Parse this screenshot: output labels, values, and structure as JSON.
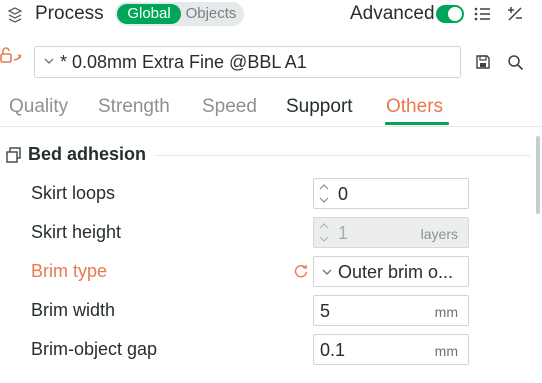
{
  "header": {
    "title": "Process",
    "segments": {
      "global": "Global",
      "objects": "Objects",
      "selected": "Global"
    },
    "advanced_label": "Advanced",
    "advanced_on": true
  },
  "preset": {
    "value": "* 0.08mm Extra Fine @BBL A1"
  },
  "tabs": {
    "items": [
      "Quality",
      "Strength",
      "Speed",
      "Support",
      "Others"
    ],
    "active": "Others"
  },
  "section": {
    "title": "Bed adhesion"
  },
  "params": {
    "skirt_loops": {
      "label": "Skirt loops",
      "value": "0"
    },
    "skirt_height": {
      "label": "Skirt height",
      "value": "1",
      "unit": "layers"
    },
    "brim_type": {
      "label": "Brim type",
      "value": "Outer brim o..."
    },
    "brim_width": {
      "label": "Brim width",
      "value": "5",
      "unit": "mm"
    },
    "brim_gap": {
      "label": "Brim-object gap",
      "value": "0.1",
      "unit": "mm"
    }
  },
  "colors": {
    "accent_green": "#00a658",
    "modified_orange": "#e87a4e",
    "text": "#262e30",
    "muted": "#8b9194"
  },
  "icons": [
    "process-icon",
    "toggle",
    "list-icon",
    "compare-icon",
    "link-icon",
    "chevron-down-icon",
    "save-icon",
    "search-icon",
    "section-icon",
    "spin-icon",
    "reset-icon"
  ]
}
